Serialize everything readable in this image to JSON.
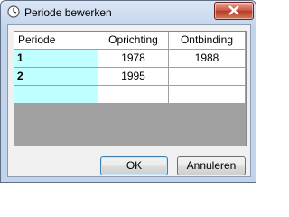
{
  "window": {
    "title": "Periode bewerken"
  },
  "grid": {
    "columns": [
      "Periode",
      "Oprichting",
      "Ontbinding"
    ],
    "rows": [
      [
        "1",
        "1978",
        "1988"
      ],
      [
        "2",
        "1995",
        ""
      ],
      [
        "",
        "",
        ""
      ]
    ]
  },
  "buttons": {
    "ok": "OK",
    "cancel": "Annuleren"
  },
  "colors": {
    "row_header": "#c0ffff",
    "grid_empty": "#a0a0a0"
  }
}
